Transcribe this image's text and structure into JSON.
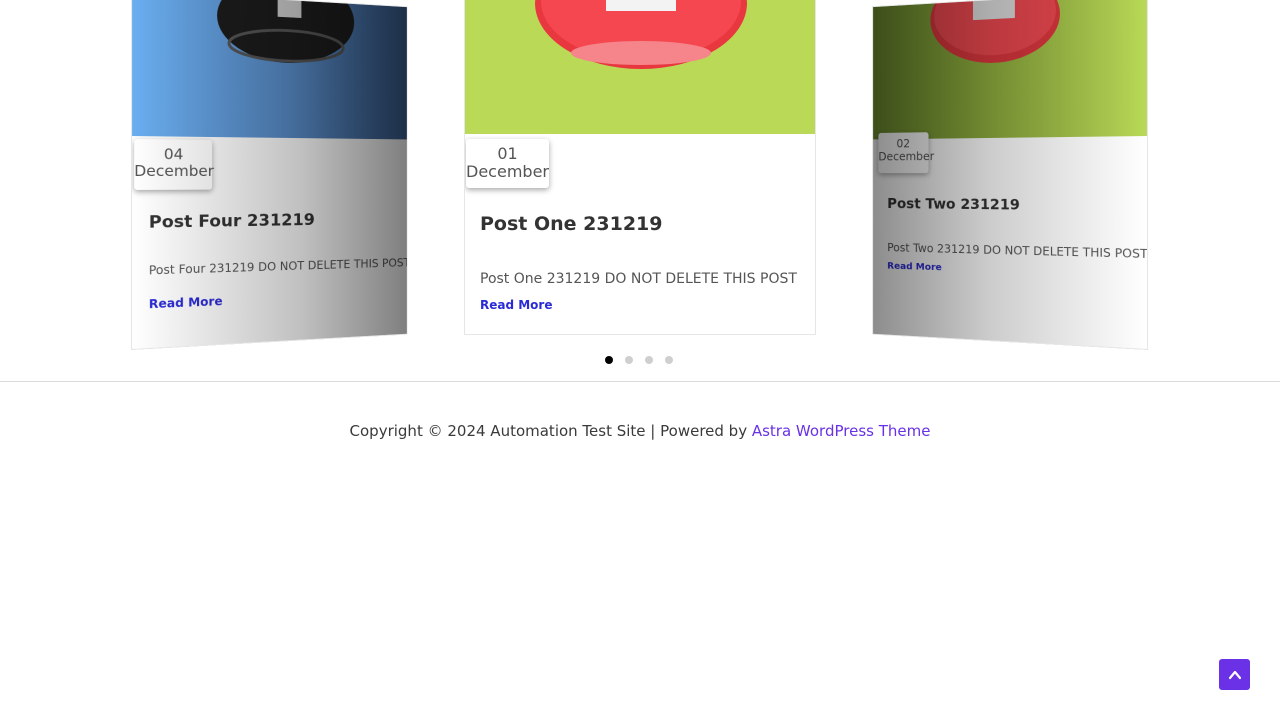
{
  "carousel": {
    "cards": [
      {
        "day": "04",
        "month": "December",
        "title": "Post Four 231219",
        "excerpt": "Post Four 231219 DO NOT DELETE THIS POST",
        "read_more": "Read More"
      },
      {
        "day": "01",
        "month": "December",
        "title": "Post One 231219",
        "excerpt": "Post One 231219 DO NOT DELETE THIS POST",
        "read_more": "Read More"
      },
      {
        "day": "02",
        "month": "December",
        "title": "Post Two 231219",
        "excerpt": "Post Two 231219 DO NOT DELETE THIS POST",
        "read_more": "Read More"
      }
    ],
    "pagination": {
      "count": 4,
      "active_index": 0
    }
  },
  "footer": {
    "copyright": "Copyright © 2024 Automation Test Site | Powered by ",
    "theme_link": "Astra WordPress Theme"
  },
  "colors": {
    "accent": "#6a31e6",
    "link": "#2b2bd6",
    "green": "#b9d957",
    "red_icon": "#f5474f",
    "blue": "#5a8fcc"
  },
  "icons": {
    "scroll_top": "chevron-up-icon"
  }
}
